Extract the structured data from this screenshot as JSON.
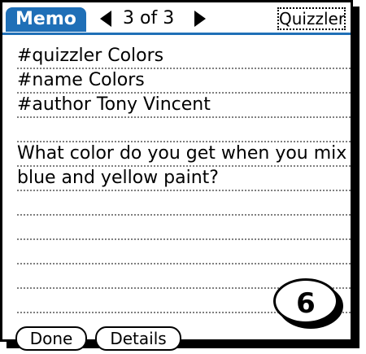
{
  "titlebar": {
    "app_label": "Memo",
    "page_indicator": "3 of 3",
    "category": "Quizzler"
  },
  "memo": {
    "lines": [
      "#quizzler Colors",
      "#name Colors",
      "#author Tony Vincent",
      "",
      "What color do you get when you mix",
      "blue and yellow paint?",
      "",
      "",
      "",
      "",
      ""
    ]
  },
  "buttons": {
    "done": "Done",
    "details": "Details"
  },
  "badge": {
    "number": "6"
  },
  "colors": {
    "accent": "#1f6fb7"
  }
}
